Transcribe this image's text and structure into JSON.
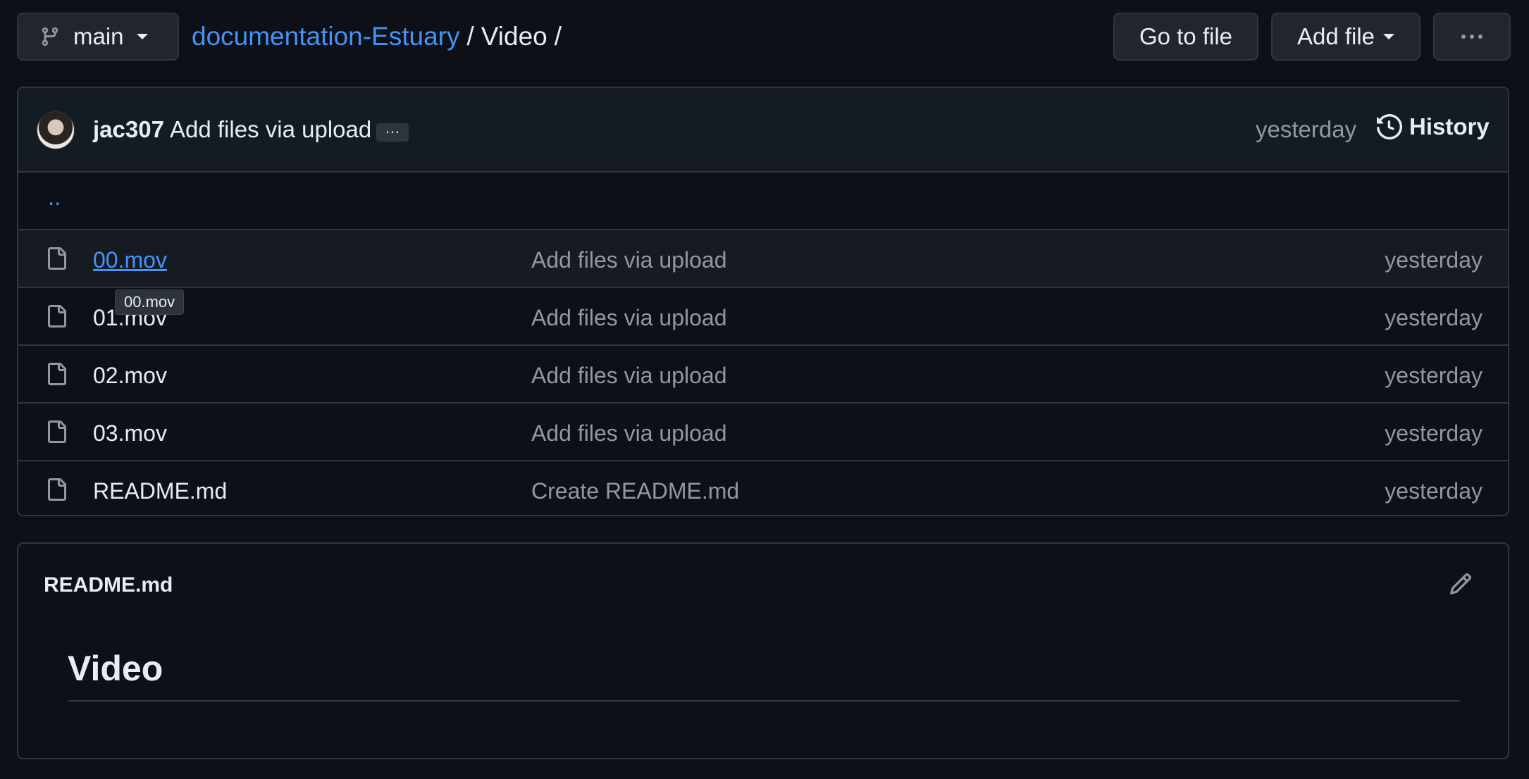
{
  "toolbar": {
    "branch": "main",
    "repo": "documentation-Estuary",
    "sep1": "/",
    "dir": "Video",
    "sep2": "/",
    "go_to_file": "Go to file",
    "add_file": "Add file"
  },
  "commit": {
    "author": "jac307",
    "message": "Add files via upload",
    "ellipsis": "…",
    "time": "yesterday",
    "history": "History"
  },
  "parent_link": "..",
  "files": [
    {
      "name": "00.mov",
      "commit": "Add files via upload",
      "time": "yesterday"
    },
    {
      "name": "01.mov",
      "commit": "Add files via upload",
      "time": "yesterday"
    },
    {
      "name": "02.mov",
      "commit": "Add files via upload",
      "time": "yesterday"
    },
    {
      "name": "03.mov",
      "commit": "Add files via upload",
      "time": "yesterday"
    },
    {
      "name": "README.md",
      "commit": "Create README.md",
      "time": "yesterday"
    }
  ],
  "tooltip": "00.mov",
  "readme": {
    "filename": "README.md",
    "heading": "Video"
  },
  "icons": {
    "branch": "git-branch-icon",
    "history": "history-icon",
    "file": "file-icon",
    "edit": "pencil-icon",
    "more": "kebab-horizontal-icon"
  }
}
